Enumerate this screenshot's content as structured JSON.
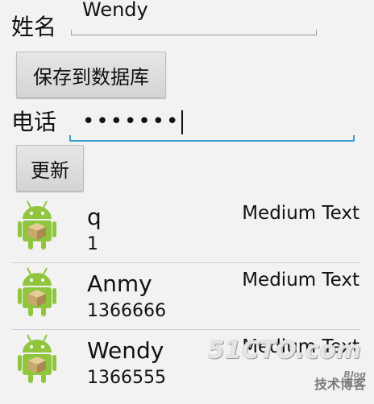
{
  "form": {
    "name_label": "姓名",
    "name_value": "Wendy",
    "save_button": "保存到数据库",
    "phone_label": "电话",
    "phone_value": "•••••••",
    "update_button": "更新"
  },
  "list": {
    "items": [
      {
        "name": "q",
        "phone": "1",
        "extra": "Medium Text"
      },
      {
        "name": "Anmy",
        "phone": "1366666",
        "extra": "Medium Text"
      },
      {
        "name": "Wendy",
        "phone": "1366555",
        "extra": "Medium Text"
      }
    ]
  },
  "watermark": {
    "site": "51CTO.com",
    "subtitle": "技术博客",
    "blog": "Blog"
  },
  "colors": {
    "focus_underline": "#33a1c9",
    "android_green": "#8fc63e",
    "box_color": "#c8a86b"
  },
  "icons": {
    "list_icon": "android-robot-icon"
  }
}
